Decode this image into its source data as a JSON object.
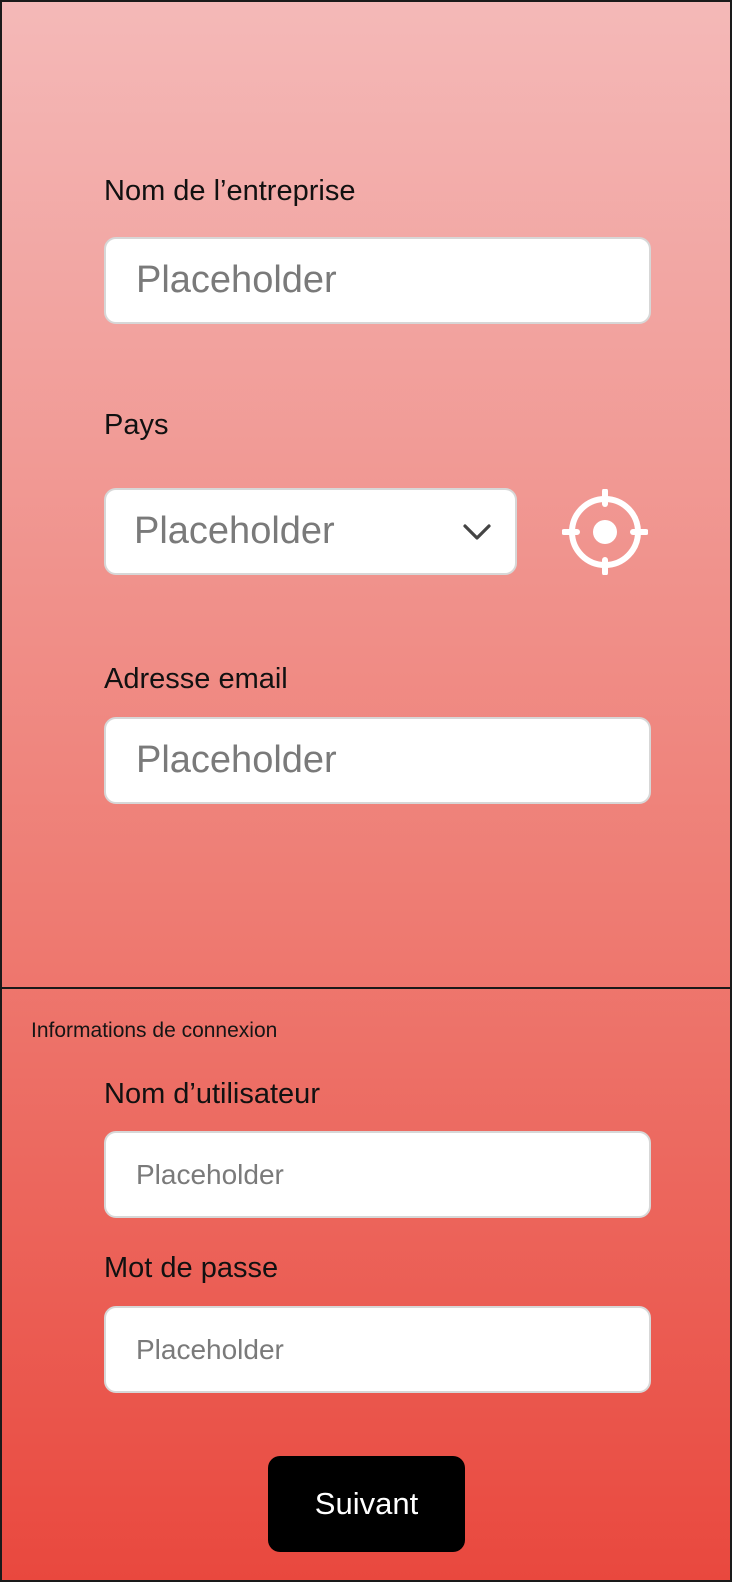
{
  "company": {
    "label": "Nom de l’entreprise",
    "placeholder": "Placeholder"
  },
  "country": {
    "label": "Pays",
    "selected": "Placeholder",
    "chevron_icon": "chevron-down-icon",
    "locate_icon": "crosshair-location-icon"
  },
  "email": {
    "label": "Adresse email",
    "placeholder": "Placeholder"
  },
  "login": {
    "section_title": "Informations de connexion",
    "username": {
      "label": "Nom d’utilisateur",
      "placeholder": "Placeholder"
    },
    "password": {
      "label": "Mot de passe",
      "placeholder": "Placeholder"
    }
  },
  "actions": {
    "next_label": "Suivant"
  },
  "colors": {
    "gradient_top": "#f4b9b8",
    "gradient_bottom": "#e9483e",
    "button_bg": "#000000",
    "button_text": "#ffffff"
  }
}
